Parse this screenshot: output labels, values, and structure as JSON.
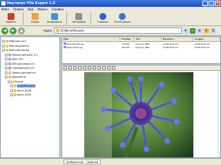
{
  "window": {
    "title": "Наутилус File Expert 1.0"
  },
  "menu": [
    "Файл",
    "Правка",
    "Вид",
    "Файлы",
    "Справка"
  ],
  "toolbar": [
    {
      "label": "Удалить",
      "icon": "delete-icon",
      "color": "#d23b2a"
    },
    {
      "label": "Буфер",
      "icon": "clipboard-icon",
      "color": "#e6a83c"
    },
    {
      "label": "Копировать",
      "icon": "copy-icon",
      "color": "#4f8dd6"
    },
    {
      "label": "Настройки",
      "icon": "tools-icon",
      "color": "#8a8f99"
    },
    {
      "label": "Справка",
      "icon": "help-icon",
      "color": "#2c63c8"
    },
    {
      "label": "Регистрация",
      "icon": "register-icon",
      "color": "#3c74d8"
    }
  ],
  "address": {
    "label": "Адрес",
    "value": "D:\\Фото\\Разное\\"
  },
  "tree": [
    {
      "label": "Рабочий стол",
      "indent": 1
    },
    {
      "label": "Мои документы",
      "indent": 1
    },
    {
      "label": "Мой компьютер",
      "indent": 1
    },
    {
      "label": "Локальный диск (C:)",
      "indent": 2,
      "drive": true
    },
    {
      "label": "Диск (D:)",
      "indent": 2,
      "drive": true
    },
    {
      "label": "DVD-дисковод (E:)",
      "indent": 2,
      "drive": true
    },
    {
      "label": "Съемный диск (F:)",
      "indent": 2,
      "drive": true
    },
    {
      "label": "Общие документы",
      "indent": 2
    },
    {
      "label": "Документы",
      "indent": 2
    },
    {
      "label": "Разное",
      "indent": 3
    },
    {
      "label": "Фото_разное",
      "indent": 4,
      "selected": true
    },
    {
      "label": "Фото_2008",
      "indent": 4
    },
    {
      "label": "Фото_2009",
      "indent": 4
    }
  ],
  "filelist": {
    "headers": [
      "Имя",
      "Размер",
      "Тип",
      "Изменен",
      "Создан"
    ],
    "rows": [
      [
        "Василек001.jpg",
        "318 КБ",
        "Рисунок JPEG",
        "12.06.2011 15:",
        "12.06.2011 15:"
      ],
      [
        "Цветок002.jpg",
        "240 КБ",
        "Рисунок JPEG",
        "12.06.2011 15:",
        "12.06.2011 15:"
      ]
    ]
  },
  "status": {
    "tab1": "Изображение",
    "tab2": "Свойства"
  },
  "colors": {
    "accent": "#316ac5",
    "flower": "#5a3fb0",
    "leaf": "#5f8a3c"
  }
}
